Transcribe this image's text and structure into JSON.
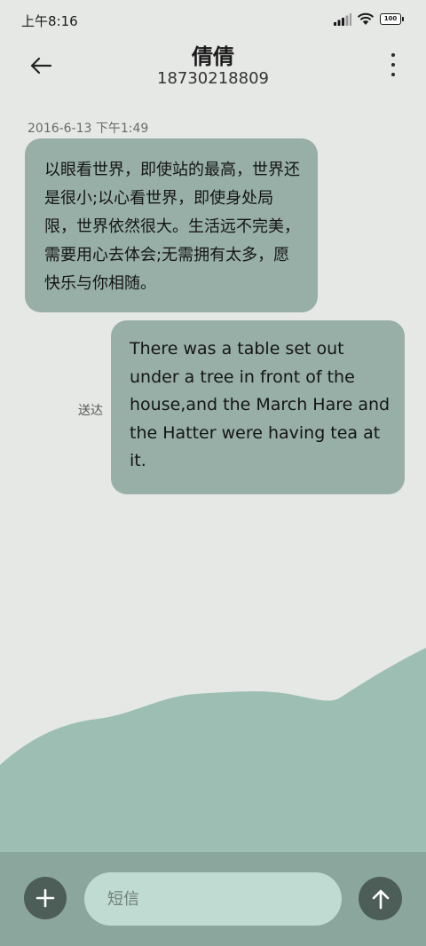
{
  "status_bar": {
    "time": "上午8:16",
    "battery_level": "100"
  },
  "header": {
    "contact_name": "倩倩",
    "contact_number": "18730218809",
    "back_icon": "arrow-left-icon",
    "more_icon": "more-vertical-icon"
  },
  "messages": [
    {
      "direction": "incoming",
      "timestamp": "2016-6-13 下午1:49",
      "text": "以眼看世界，即使站的最高，世界还是很小;以心看世界，即使身处局限，世界依然很大。生活远不完美，需要用心去体会;无需拥有太多，愿快乐与你相随。"
    },
    {
      "direction": "outgoing",
      "status": "送达",
      "text": "There was a table set out under a tree in front of the house,and the March Hare and the Hatter were having tea at it."
    }
  ],
  "composer": {
    "placeholder": "短信",
    "add_icon": "plus-icon",
    "send_icon": "arrow-up-icon"
  },
  "colors": {
    "background": "#e6e8e5",
    "bubble": "#98afa8",
    "wave": "#9dbfb3",
    "bottom_bar": "#8aa69d",
    "input": "#c0dbd2",
    "button": "#4d5d57"
  }
}
